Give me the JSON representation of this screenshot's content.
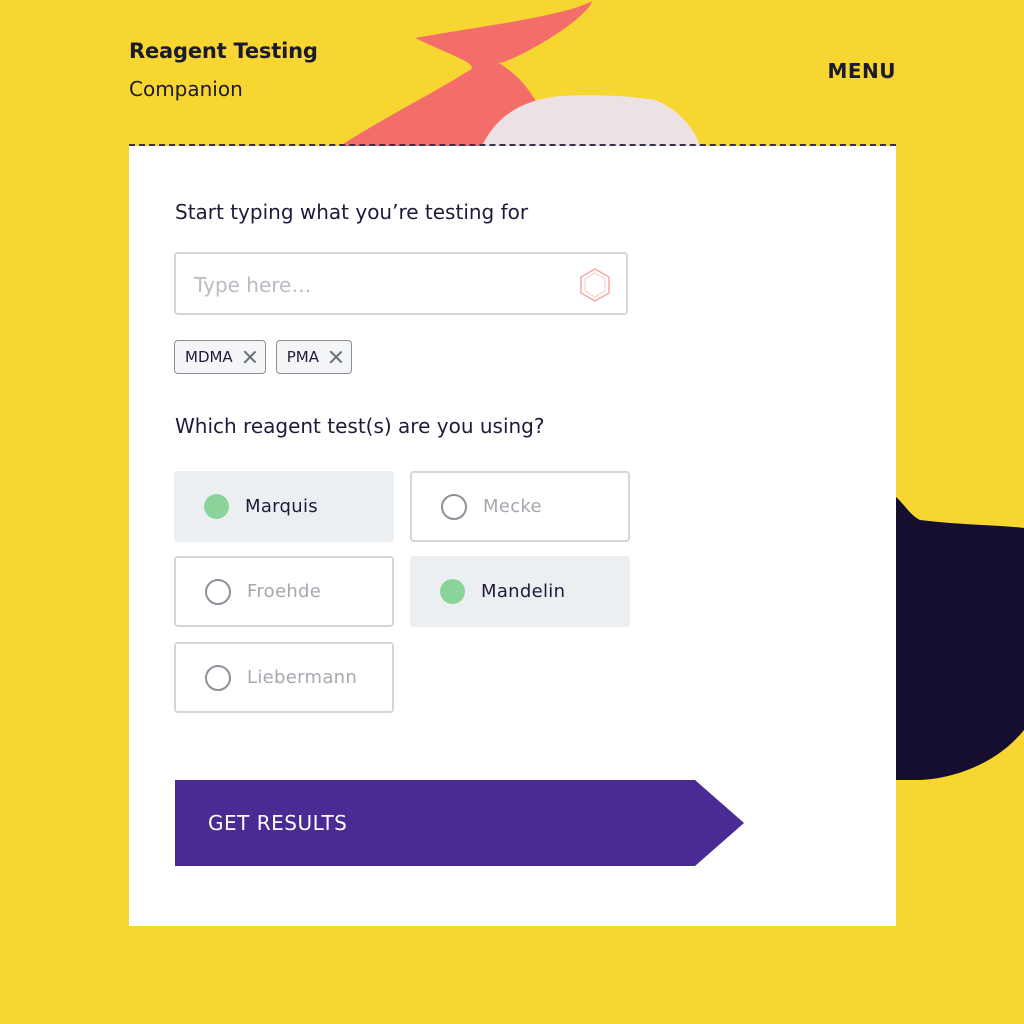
{
  "header": {
    "title": "Reagent Testing",
    "subtitle": "Companion",
    "menu_label": "MENU"
  },
  "form": {
    "search_label": "Start typing what you’re testing for",
    "search_placeholder": "Type here…",
    "search_icon": "hexagon-icon",
    "chips": [
      "MDMA",
      "PMA"
    ],
    "reagent_label": "Which reagent test(s) are you using?",
    "options": [
      {
        "label": "Marquis",
        "selected": true
      },
      {
        "label": "Mecke",
        "selected": false
      },
      {
        "label": "Froehde",
        "selected": false
      },
      {
        "label": "Mandelin",
        "selected": true
      },
      {
        "label": "Liebermann",
        "selected": false
      }
    ],
    "submit_label": "GET RESULTS"
  },
  "colors": {
    "background": "#F7D631",
    "card": "#FFFFFF",
    "accent_button": "#4A2A93",
    "selected_dot": "#8AD49A",
    "selected_bg": "#ECEFF2",
    "shape_coral": "#F36D6B",
    "shape_navy": "#160E2E",
    "shape_blush": "#EDE2E3"
  }
}
